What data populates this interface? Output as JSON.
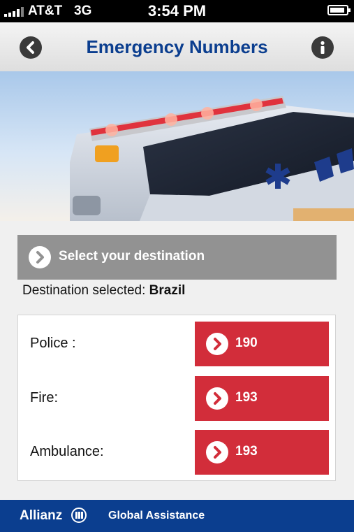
{
  "status_bar": {
    "carrier": "AT&T",
    "network": "3G",
    "time": "3:54 PM"
  },
  "header": {
    "title": "Emergency Numbers",
    "back_icon": "chevron-left-icon",
    "info_icon": "info-icon"
  },
  "hero_image": {
    "subject": "ambulance"
  },
  "destination": {
    "button_label": "Select your destination",
    "selected_prefix": "Destination selected:",
    "selected_value": "Brazil"
  },
  "numbers": [
    {
      "label": "Police :",
      "number": "190"
    },
    {
      "label": "Fire:",
      "number": "193"
    },
    {
      "label": "Ambulance:",
      "number": "193"
    }
  ],
  "footer": {
    "brand": "Allianz",
    "service": "Global Assistance"
  },
  "colors": {
    "accent_red": "#d22d3a",
    "brand_blue": "#0b3e8f",
    "title_blue": "#0b3e8f",
    "selector_gray": "#929292"
  }
}
